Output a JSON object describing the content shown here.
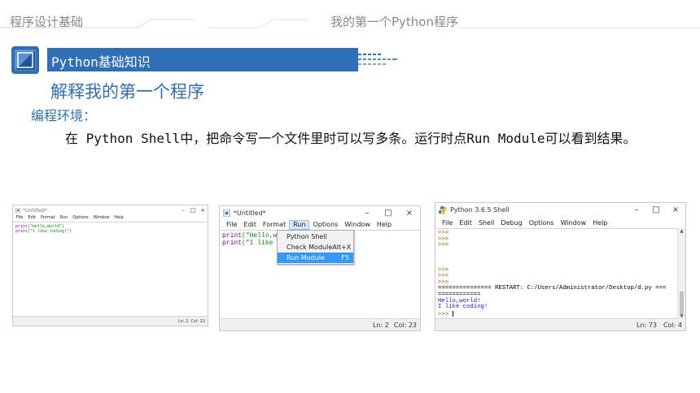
{
  "header": {
    "course": "程序设计基础",
    "lesson": "我的第一个Python程序"
  },
  "section": {
    "title": "Python基础知识",
    "subtitle": "解释我的第一个程序"
  },
  "content": {
    "env_label": "编程环境：",
    "paragraph": "在 Python Shell中，把命令写一个文件里时可以写多条。运行时点Run Module可以看到结果。"
  },
  "colors": {
    "accent": "#2e6fb8",
    "keyword": "#8b00a8",
    "string": "#0a8a17",
    "output": "#1a1acc",
    "selection": "#3399ff"
  },
  "windows": {
    "editor_small": {
      "title": "*Untitled*",
      "menu": [
        "File",
        "Edit",
        "Format",
        "Run",
        "Options",
        "Window",
        "Help"
      ],
      "code": [
        {
          "kw": "print",
          "str": "(\"Hello,World\")"
        },
        {
          "kw": "print",
          "str": "(\"I like coding!\")"
        }
      ],
      "status": {
        "ln": "Ln: 2",
        "col": "Col: 22"
      }
    },
    "editor_run": {
      "title": "*Untitled*",
      "menu": [
        "File",
        "Edit",
        "Format",
        "Run",
        "Options",
        "Window",
        "Help"
      ],
      "active_menu": "Run",
      "code": [
        {
          "kw": "print",
          "str": "(\"Hello,worl"
        },
        {
          "kw": "print",
          "str": "(\"I like cod"
        }
      ],
      "dropdown": [
        {
          "label": "Python Shell",
          "shortcut": ""
        },
        {
          "label": "Check Module",
          "shortcut": "Alt+X"
        },
        {
          "label": "Run Module",
          "shortcut": "F5",
          "selected": true
        }
      ],
      "status": {
        "ln": "Ln: 2",
        "col": "Col: 23"
      }
    },
    "shell": {
      "title": "Python 3.6.5 Shell",
      "menu": [
        "File",
        "Edit",
        "Shell",
        "Debug",
        "Options",
        "Window",
        "Help"
      ],
      "prompt": ">>>",
      "restart_line": "=============== RESTART: C:/Users/Administrator/Desktop/d.py ===",
      "restart_tail": "============",
      "output": [
        "Hello,world!",
        "I like coding!"
      ],
      "status": {
        "ln": "Ln: 73",
        "col": "Col: 4"
      }
    }
  }
}
